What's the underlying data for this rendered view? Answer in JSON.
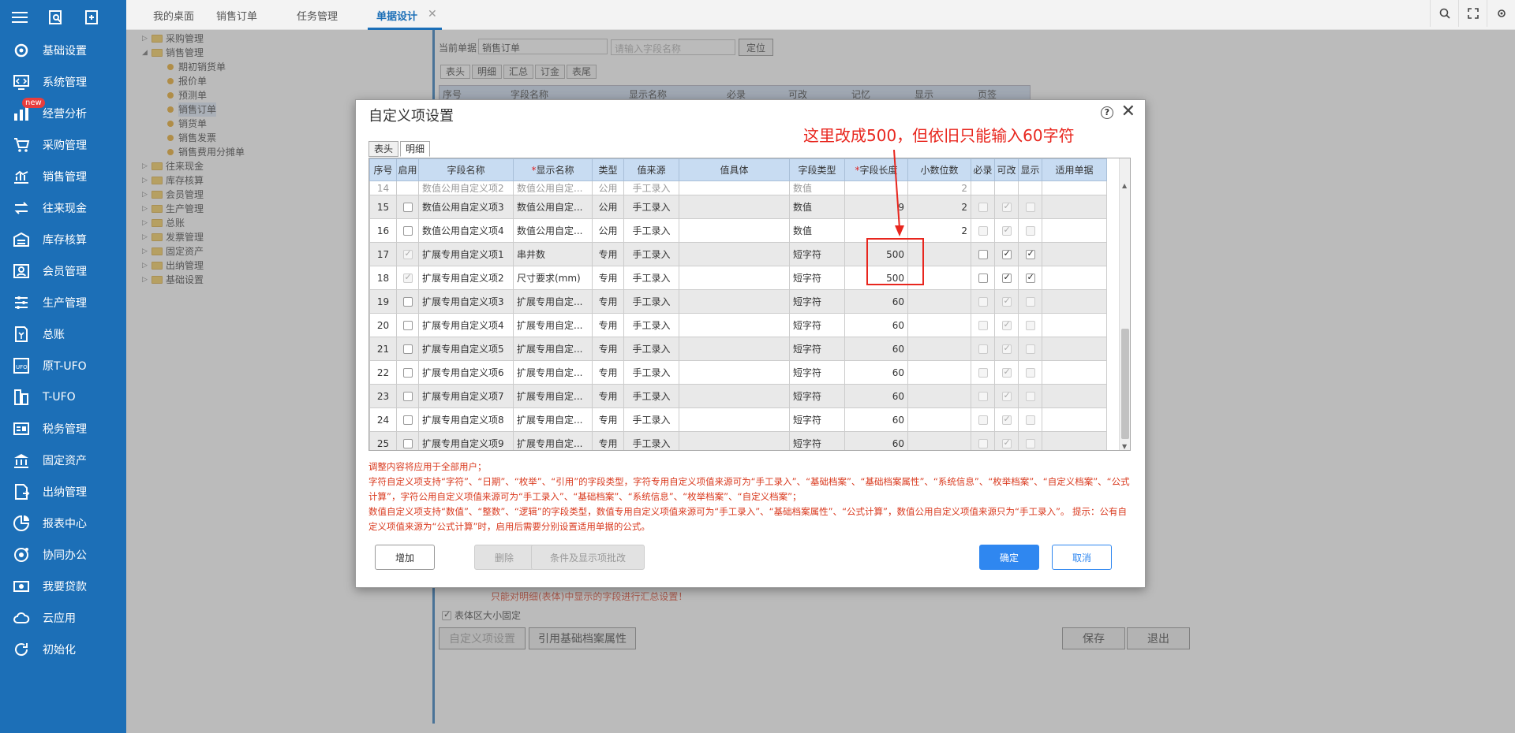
{
  "sidebar": {
    "top_icons": [
      "menu-icon",
      "search-doc-icon",
      "add-doc-icon"
    ],
    "new_badge": "new",
    "items": [
      {
        "label": "基础设置",
        "icon": "gear-icon"
      },
      {
        "label": "系统管理",
        "icon": "code-icon"
      },
      {
        "label": "经营分析",
        "icon": "chart-icon"
      },
      {
        "label": "采购管理",
        "icon": "cart-icon"
      },
      {
        "label": "销售管理",
        "icon": "bar-chart-icon"
      },
      {
        "label": "往来现金",
        "icon": "exchange-icon"
      },
      {
        "label": "库存核算",
        "icon": "warehouse-icon"
      },
      {
        "label": "会员管理",
        "icon": "member-icon"
      },
      {
        "label": "生产管理",
        "icon": "sliders-icon"
      },
      {
        "label": "总账",
        "icon": "ledger-icon"
      },
      {
        "label": "原T-UFO",
        "icon": "ufo-icon"
      },
      {
        "label": "T-UFO",
        "icon": "building-icon"
      },
      {
        "label": "税务管理",
        "icon": "tax-icon"
      },
      {
        "label": "固定资产",
        "icon": "bank-icon"
      },
      {
        "label": "出纳管理",
        "icon": "cashier-icon"
      },
      {
        "label": "报表中心",
        "icon": "pie-chart-icon"
      },
      {
        "label": "协同办公",
        "icon": "collab-icon"
      },
      {
        "label": "我要贷款",
        "icon": "money-icon"
      },
      {
        "label": "云应用",
        "icon": "cloud-icon"
      },
      {
        "label": "初始化",
        "icon": "refresh-icon"
      }
    ]
  },
  "tabs": [
    {
      "label": "我的桌面"
    },
    {
      "label": "销售订单"
    },
    {
      "label": "任务管理"
    },
    {
      "label": "单据设计"
    }
  ],
  "tree": [
    {
      "label": "采购管理",
      "level": 0,
      "type": "folder",
      "arrow": "▷"
    },
    {
      "label": "销售管理",
      "level": 0,
      "type": "folder",
      "arrow": "◢"
    },
    {
      "label": "期初销货单",
      "level": 1,
      "type": "doc"
    },
    {
      "label": "报价单",
      "level": 1,
      "type": "doc"
    },
    {
      "label": "预测单",
      "level": 1,
      "type": "doc"
    },
    {
      "label": "销售订单",
      "level": 1,
      "type": "doc"
    },
    {
      "label": "销货单",
      "level": 1,
      "type": "doc"
    },
    {
      "label": "销售发票",
      "level": 1,
      "type": "doc"
    },
    {
      "label": "销售费用分摊单",
      "level": 1,
      "type": "doc"
    },
    {
      "label": "往来现金",
      "level": 0,
      "type": "folder",
      "arrow": "▷"
    },
    {
      "label": "库存核算",
      "level": 0,
      "type": "folder",
      "arrow": "▷"
    },
    {
      "label": "会员管理",
      "level": 0,
      "type": "folder",
      "arrow": "▷"
    },
    {
      "label": "生产管理",
      "level": 0,
      "type": "folder",
      "arrow": "▷"
    },
    {
      "label": "总账",
      "level": 0,
      "type": "folder",
      "arrow": "▷"
    },
    {
      "label": "发票管理",
      "level": 0,
      "type": "folder",
      "arrow": "▷"
    },
    {
      "label": "固定资产",
      "level": 0,
      "type": "folder",
      "arrow": "▷"
    },
    {
      "label": "出纳管理",
      "level": 0,
      "type": "folder",
      "arrow": "▷"
    },
    {
      "label": "基础设置",
      "level": 0,
      "type": "folder",
      "arrow": "▷"
    }
  ],
  "bgform": {
    "current_doc_label": "当前单据",
    "current_doc_value": "销售订单",
    "field_search_placeholder": "请输入字段名称",
    "locate_button": "定位",
    "subtabs": [
      "表头",
      "明细",
      "汇总",
      "订金",
      "表尾"
    ],
    "header_cols": [
      "序号",
      "字段名称",
      "显示名称",
      "必录",
      "可改",
      "记忆",
      "显示",
      "页签"
    ],
    "note": "只能对明细(表体)中显示的字段进行汇总设置！",
    "fixed_size_label": "表体区大小固定",
    "custom_button": "自定义项设置",
    "ref_button": "引用基础档案属性",
    "save_button": "保存",
    "exit_button": "退出"
  },
  "dialog": {
    "title": "自定义项设置",
    "tabs": [
      "表头",
      "明细"
    ],
    "columns": [
      "序号",
      "启用",
      "字段名称",
      "显示名称",
      "类型",
      "值来源",
      "值具体",
      "字段类型",
      "字段长度",
      "小数位数",
      "必录",
      "可改",
      "显示",
      "适用单据"
    ],
    "partial_row": {
      "idx": "14",
      "name": "数值公用自定义项2",
      "display": "数值公用自定...",
      "type": "公用",
      "source": "手工录入",
      "field_type": "数值",
      "decimals": "2"
    },
    "rows": [
      {
        "idx": "15",
        "enabled": false,
        "enabled_dis": false,
        "name": "数值公用自定义项3",
        "display": "数值公用自定...",
        "type": "公用",
        "source": "手工录入",
        "field_type": "数值",
        "length": "9",
        "decimals": "2",
        "required": false,
        "editable": true,
        "show": false,
        "active": false
      },
      {
        "idx": "16",
        "enabled": false,
        "enabled_dis": false,
        "name": "数值公用自定义项4",
        "display": "数值公用自定...",
        "type": "公用",
        "source": "手工录入",
        "field_type": "数值",
        "length": "",
        "decimals": "2",
        "required": false,
        "editable": true,
        "show": false,
        "active": false
      },
      {
        "idx": "17",
        "enabled": true,
        "enabled_dis": true,
        "name": "扩展专用自定义项1",
        "display": "串井数",
        "type": "专用",
        "source": "手工录入",
        "field_type": "短字符",
        "length": "500",
        "decimals": "",
        "required": false,
        "editable": true,
        "show": true,
        "active": true
      },
      {
        "idx": "18",
        "enabled": true,
        "enabled_dis": true,
        "name": "扩展专用自定义项2",
        "display": "尺寸要求(mm)",
        "type": "专用",
        "source": "手工录入",
        "field_type": "短字符",
        "length": "500",
        "decimals": "",
        "required": false,
        "editable": true,
        "show": true,
        "active": true
      },
      {
        "idx": "19",
        "enabled": false,
        "enabled_dis": false,
        "name": "扩展专用自定义项3",
        "display": "扩展专用自定...",
        "type": "专用",
        "source": "手工录入",
        "field_type": "短字符",
        "length": "60",
        "decimals": "",
        "required": false,
        "editable": true,
        "show": false,
        "active": false
      },
      {
        "idx": "20",
        "enabled": false,
        "enabled_dis": false,
        "name": "扩展专用自定义项4",
        "display": "扩展专用自定...",
        "type": "专用",
        "source": "手工录入",
        "field_type": "短字符",
        "length": "60",
        "decimals": "",
        "required": false,
        "editable": true,
        "show": false,
        "active": false
      },
      {
        "idx": "21",
        "enabled": false,
        "enabled_dis": false,
        "name": "扩展专用自定义项5",
        "display": "扩展专用自定...",
        "type": "专用",
        "source": "手工录入",
        "field_type": "短字符",
        "length": "60",
        "decimals": "",
        "required": false,
        "editable": true,
        "show": false,
        "active": false
      },
      {
        "idx": "22",
        "enabled": false,
        "enabled_dis": false,
        "name": "扩展专用自定义项6",
        "display": "扩展专用自定...",
        "type": "专用",
        "source": "手工录入",
        "field_type": "短字符",
        "length": "60",
        "decimals": "",
        "required": false,
        "editable": true,
        "show": false,
        "active": false
      },
      {
        "idx": "23",
        "enabled": false,
        "enabled_dis": false,
        "name": "扩展专用自定义项7",
        "display": "扩展专用自定...",
        "type": "专用",
        "source": "手工录入",
        "field_type": "短字符",
        "length": "60",
        "decimals": "",
        "required": false,
        "editable": true,
        "show": false,
        "active": false
      },
      {
        "idx": "24",
        "enabled": false,
        "enabled_dis": false,
        "name": "扩展专用自定义项8",
        "display": "扩展专用自定...",
        "type": "专用",
        "source": "手工录入",
        "field_type": "短字符",
        "length": "60",
        "decimals": "",
        "required": false,
        "editable": true,
        "show": false,
        "active": false
      },
      {
        "idx": "25",
        "enabled": false,
        "enabled_dis": false,
        "name": "扩展专用自定义项9",
        "display": "扩展专用自定...",
        "type": "专用",
        "source": "手工录入",
        "field_type": "短字符",
        "length": "60",
        "decimals": "",
        "required": false,
        "editable": true,
        "show": false,
        "active": false
      }
    ],
    "notes": [
      "调整内容将应用于全部用户；",
      "字符自定义项支持“字符”、“日期”、“枚举”、“引用”的字段类型，字符专用自定义项值来源可为“手工录入”、“基础档案”、“基础档案属性”、“系统信息”、“枚举档案”、“自定义档案”、“公式计算”，字符公用自定义项值来源可为“手工录入”、“基础档案”、“系统信息”、“枚举档案”、“自定义档案”；",
      "数值自定义项支持“数值”、“整数”、“逻辑”的字段类型，数值专用自定义项值来源可为“手工录入”、“基础档案属性”、“公式计算”，数值公用自定义项值来源只为“手工录入”。 提示：公有自定义项值来源为“公式计算”时，启用后需要分别设置适用单据的公式。"
    ],
    "buttons": {
      "add": "增加",
      "delete": "删除",
      "batch": "条件及显示项批改",
      "ok": "确定",
      "cancel": "取消"
    }
  },
  "annotation": {
    "text": "这里改成500，但依旧只能输入60字符",
    "color": "#e8261e"
  },
  "colors": {
    "sidebar": "#1c6fb7",
    "primary_button": "#2f87f0",
    "header_row": "#c8dcf2",
    "note_text": "#d9391e"
  }
}
